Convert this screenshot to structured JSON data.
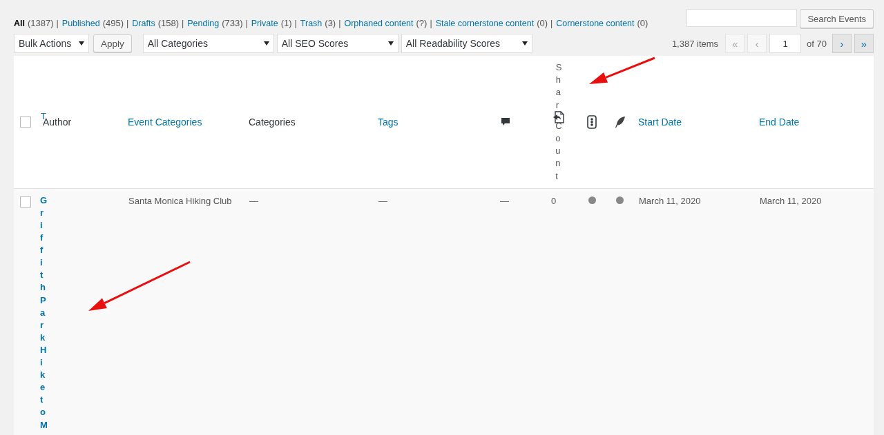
{
  "status_links": [
    {
      "label": "All",
      "count": "(1387)",
      "selected": true,
      "separator": "|"
    },
    {
      "label": "Published",
      "count": "(495)",
      "selected": false,
      "separator": "|"
    },
    {
      "label": "Drafts",
      "count": "(158)",
      "selected": false,
      "separator": "|"
    },
    {
      "label": "Pending",
      "count": "(733)",
      "selected": false,
      "separator": "|"
    },
    {
      "label": "Private",
      "count": "(1)",
      "selected": false,
      "separator": "|"
    },
    {
      "label": "Trash",
      "count": "(3)",
      "selected": false,
      "separator": "|"
    },
    {
      "label": "Orphaned content",
      "count": "(?)",
      "selected": false,
      "separator": "|"
    },
    {
      "label": "Stale cornerstone content",
      "count": "(0)",
      "selected": false,
      "separator": "|"
    },
    {
      "label": "Cornerstone content",
      "count": "(0)",
      "selected": false
    }
  ],
  "search": {
    "button": "Search Events"
  },
  "filters": {
    "bulk_actions": "Bulk Actions",
    "apply": "Apply",
    "dropdowns": [
      "All Categories",
      "All SEO Scores",
      "All Readability Scores"
    ]
  },
  "pagination": {
    "items": "1,387 items",
    "page": "1",
    "of": "of 70",
    "buttons": [
      {
        "label": "«",
        "disabled": true
      },
      {
        "label": "‹",
        "disabled": true
      },
      {
        "label": "›",
        "disabled": false
      },
      {
        "label": "»",
        "disabled": false
      }
    ]
  },
  "table": {
    "columns": [
      {
        "kind": "checkbox",
        "checked": false
      },
      {
        "kind": "link",
        "label": "T"
      },
      {
        "kind": "text",
        "label": "Author"
      },
      {
        "kind": "link",
        "label": "Event Categories"
      },
      {
        "kind": "text",
        "label": "Categories"
      },
      {
        "kind": "link",
        "label": "Tags"
      },
      {
        "kind": "comments"
      },
      {
        "kind": "share",
        "label_top": "Shar",
        "label_bottom": "Count"
      },
      {
        "kind": "seo"
      },
      {
        "kind": "readability"
      },
      {
        "kind": "link",
        "label": "Start Date"
      },
      {
        "kind": "link",
        "label": "End Date"
      }
    ],
    "rows": [
      {
        "cells": [
          {
            "kind": "checkbox",
            "checked": false
          },
          {
            "kind": "vertical",
            "text": "GriffithParkHiketoM"
          },
          {
            "kind": "blank"
          },
          {
            "kind": "text",
            "text": "Santa Monica Hiking Club"
          },
          {
            "kind": "text",
            "text": "—"
          },
          {
            "kind": "text",
            "text": "—"
          },
          {
            "kind": "text",
            "text": "—"
          },
          {
            "kind": "text",
            "text": "0"
          },
          {
            "kind": "dot",
            "color": "#888888"
          },
          {
            "kind": "dot",
            "color": "#888888"
          },
          {
            "kind": "text",
            "text": "March 11, 2020"
          },
          {
            "kind": "text",
            "text": "March 11, 2020"
          }
        ]
      }
    ]
  }
}
